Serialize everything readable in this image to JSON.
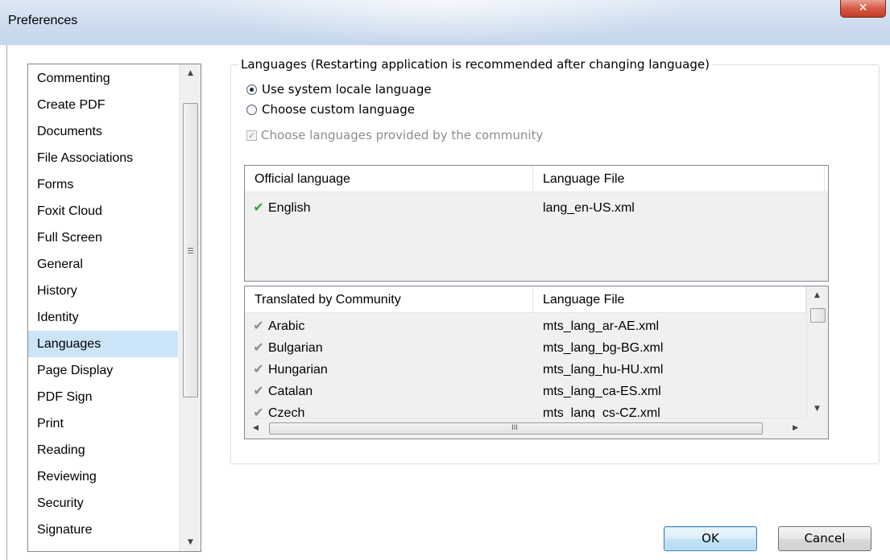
{
  "window": {
    "title": "Preferences",
    "close_glyph": "✕"
  },
  "sidebar": {
    "items": [
      {
        "label": "Commenting"
      },
      {
        "label": "Create PDF"
      },
      {
        "label": "Documents"
      },
      {
        "label": "File Associations"
      },
      {
        "label": "Forms"
      },
      {
        "label": "Foxit Cloud"
      },
      {
        "label": "Full Screen"
      },
      {
        "label": "General"
      },
      {
        "label": "History"
      },
      {
        "label": "Identity"
      },
      {
        "label": "Languages"
      },
      {
        "label": "Page Display"
      },
      {
        "label": "PDF Sign"
      },
      {
        "label": "Print"
      },
      {
        "label": "Reading"
      },
      {
        "label": "Reviewing"
      },
      {
        "label": "Security"
      },
      {
        "label": "Signature"
      }
    ],
    "selected": "Languages"
  },
  "languages": {
    "group_title": "Languages (Restarting application is recommended after changing language)",
    "use_system_locale": "Use system locale language",
    "choose_custom": "Choose custom language",
    "choose_community": "Choose languages provided by the community",
    "selected_option": "use_system_locale",
    "community_checked": true,
    "community_disabled": true
  },
  "official_table": {
    "headers": [
      "Official language",
      "Language File"
    ],
    "rows": [
      {
        "language": "English",
        "file": "lang_en-US.xml",
        "check": "green-check-icon"
      }
    ]
  },
  "community_table": {
    "headers": [
      "Translated by Community",
      "Language File"
    ],
    "rows": [
      {
        "language": "Arabic",
        "file": "mts_lang_ar-AE.xml",
        "check": "gray-check-icon"
      },
      {
        "language": "Bulgarian",
        "file": "mts_lang_bg-BG.xml",
        "check": "gray-check-icon"
      },
      {
        "language": "Hungarian",
        "file": "mts_lang_hu-HU.xml",
        "check": "gray-check-icon"
      },
      {
        "language": "Catalan",
        "file": "mts_lang_ca-ES.xml",
        "check": "gray-check-icon"
      },
      {
        "language": "Czech",
        "file": "mts_lang_cs-CZ.xml",
        "check": "gray-check-icon"
      }
    ]
  },
  "buttons": {
    "ok": "OK",
    "cancel": "Cancel"
  },
  "colors": {
    "selection": "#cce4f7",
    "check_green": "#2ea82e",
    "close_red": "#c43b26"
  }
}
